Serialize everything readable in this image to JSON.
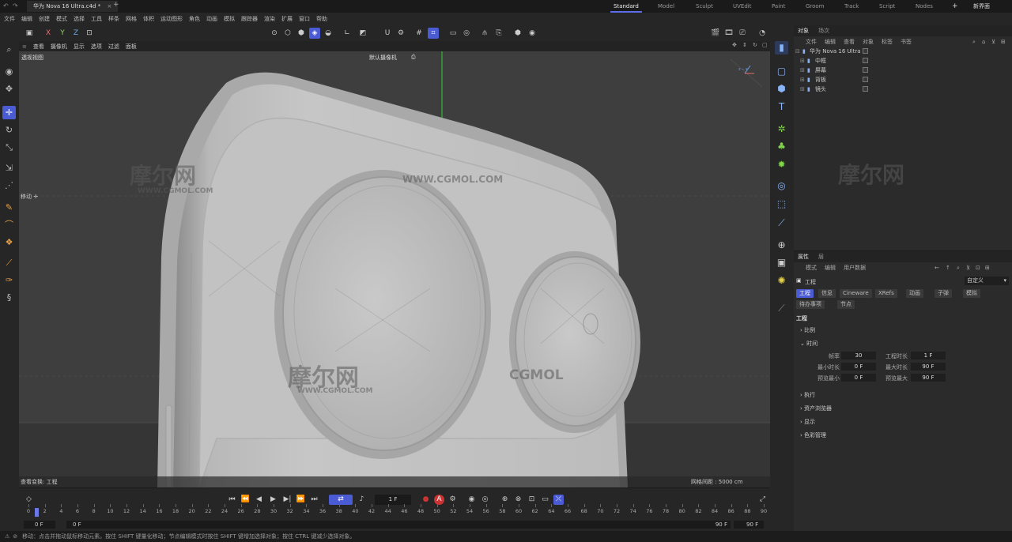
{
  "titlebar": {
    "tab_title": "华为 Nova 16 Ultra.c4d *",
    "new_tab": "+",
    "workspaces": [
      "Standard",
      "Model",
      "Sculpt",
      "UVEdit",
      "Paint",
      "Groom",
      "Track",
      "Script",
      "Nodes"
    ],
    "active_workspace": "Standard",
    "add_layout": "+",
    "new_ui_label": "新界面"
  },
  "menubar": [
    "文件",
    "编辑",
    "创建",
    "模式",
    "选择",
    "工具",
    "样条",
    "网格",
    "体积",
    "运动图形",
    "角色",
    "动画",
    "模拟",
    "跟踪器",
    "渲染",
    "扩展",
    "窗口",
    "帮助"
  ],
  "toolbar": {
    "axis_x": "X",
    "axis_y": "Y",
    "axis_z": "Z"
  },
  "viewport": {
    "menu": [
      "查看",
      "摄像机",
      "显示",
      "选项",
      "过滤",
      "面板"
    ],
    "view_name": "透视视图",
    "camera_name": "默认摄像机",
    "camera_icon": "camera-icon",
    "move_label": "移动",
    "transform_label": "查看变换",
    "transform_value": "工程",
    "grid_spacing": "网格间距 : 5000 cm",
    "watermarks": [
      "摩尔网",
      "WWW.CGMOL.COM",
      "WWW.CGMOL.COM",
      "摩尔网",
      "WWW.CGMOL.COM",
      "CGMOL"
    ]
  },
  "objects": {
    "tabs": [
      "对象",
      "场次"
    ],
    "menu": [
      "文件",
      "编辑",
      "查看",
      "对象",
      "标签",
      "书签"
    ],
    "items": [
      {
        "name": "华为 Nova 16 Ultra",
        "level": 0
      },
      {
        "name": "中框",
        "level": 1
      },
      {
        "name": "屏幕",
        "level": 1
      },
      {
        "name": "背板",
        "level": 1
      },
      {
        "name": "镜头",
        "level": 1
      }
    ],
    "watermark": "摩尔网"
  },
  "attributes": {
    "tabs": [
      "属性",
      "层"
    ],
    "menu": [
      "模式",
      "编辑",
      "用户数据"
    ],
    "object_label": "工程",
    "preset": "自定义",
    "page_tabs": [
      "工程",
      "信息",
      "Cineware",
      "XRefs",
      "动画",
      "子弹",
      "模拟",
      "待办事项",
      "节点"
    ],
    "section_title": "工程",
    "groups": [
      "比例",
      "时间",
      "执行",
      "资产浏览器",
      "显示",
      "色彩管理"
    ],
    "fields": {
      "fps_label": "帧率",
      "fps_value": "30",
      "project_time_label": "工程时长",
      "project_time_value": "1 F",
      "min_time_label": "最小时长",
      "min_time_value": "0 F",
      "max_time_label": "最大时长",
      "max_time_value": "90 F",
      "preview_min_label": "预览最小",
      "preview_min_value": "0 F",
      "preview_max_label": "预览最大",
      "preview_max_value": "90 F"
    }
  },
  "timeline": {
    "frames": [
      "0",
      "2",
      "4",
      "6",
      "8",
      "10",
      "12",
      "14",
      "16",
      "18",
      "20",
      "22",
      "24",
      "26",
      "28",
      "30",
      "32",
      "34",
      "36",
      "38",
      "40",
      "42",
      "44",
      "46",
      "48",
      "50",
      "52",
      "54",
      "56",
      "58",
      "60",
      "62",
      "64",
      "66",
      "68",
      "70",
      "72",
      "74",
      "76",
      "78",
      "80",
      "82",
      "84",
      "86",
      "88",
      "90"
    ],
    "current_frame": "1 F",
    "start_a": "0 F",
    "start_b": "0 F",
    "end_a": "90 F",
    "end_b": "90 F"
  },
  "status": {
    "text": "移动：点击并拖动鼠标移动元素。按住 SHIFT 键量化移动；节点编辑模式时按住 SHIFT 键增加选择对象；按住 CTRL 键减少选择对象。"
  },
  "colors": {
    "accent": "#4a5bd4",
    "viewport_bg": "#3e3e3e",
    "model": "#c4c4c4",
    "axis_green": "#2fd12f"
  }
}
